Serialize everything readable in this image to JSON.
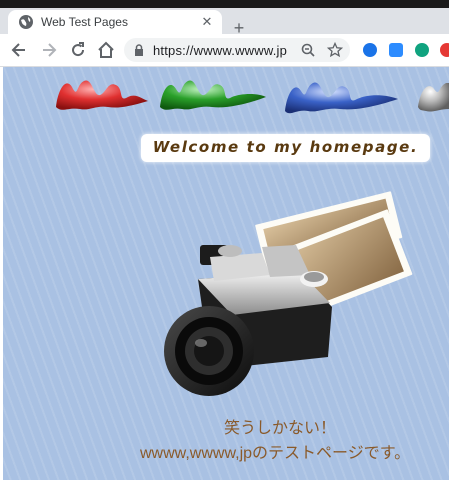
{
  "browser": {
    "tab_title": "Web Test Pages",
    "tab_close": "✕",
    "new_tab": "+",
    "url": "https://wwww.wwww.jp"
  },
  "page": {
    "welcome_text": "Welcome to my homepage.",
    "message_line1": "笑うしかない！",
    "message_line2": "wwww,wwww,jpのテストページです。"
  },
  "colors": {
    "background": "#a9c1e3",
    "text_brown": "#8a5a2a",
    "w_red": "#e03030",
    "w_green": "#2aa02a",
    "w_blue": "#3a62c8"
  }
}
